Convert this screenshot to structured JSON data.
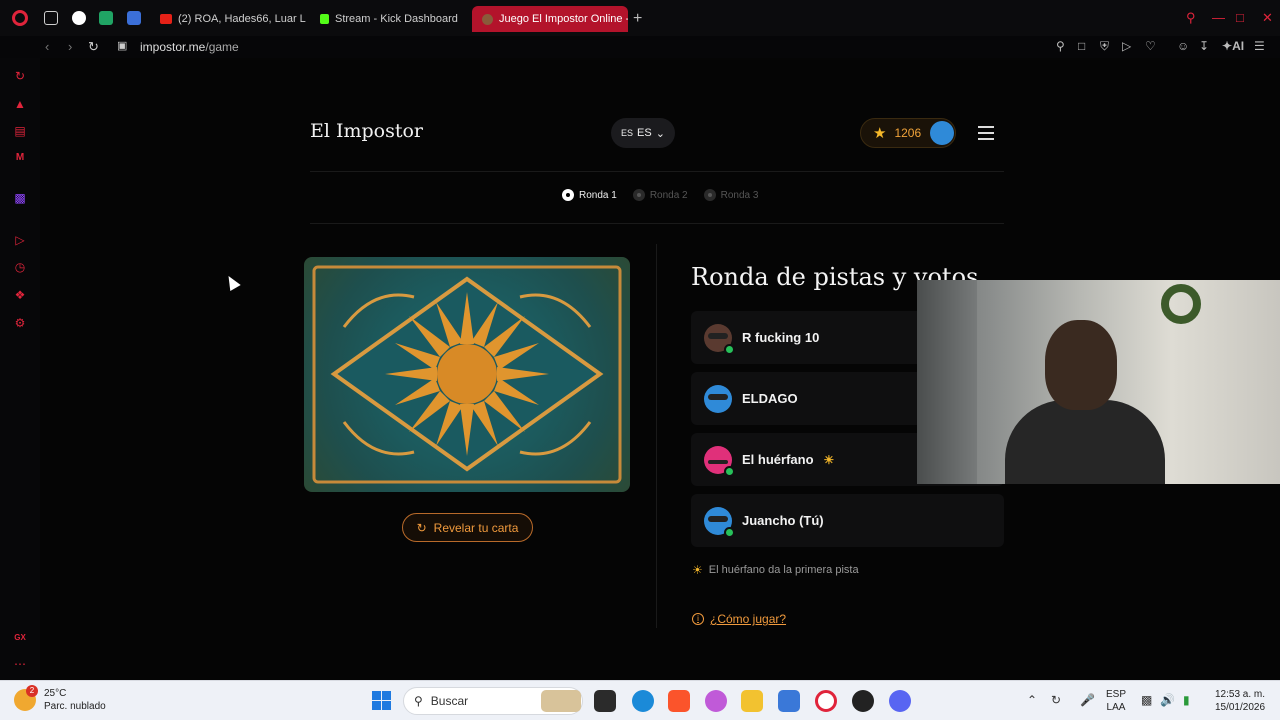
{
  "browser": {
    "tabs": [
      {
        "title": "(2) ROA, Hades66, Luar La",
        "favicon_color": "#e62117"
      },
      {
        "title": "Stream - Kick Dashboard",
        "favicon_color": "#53fc18"
      },
      {
        "title": "Juego El Impostor Online -",
        "favicon_color": "#8a5a3a",
        "active": true
      }
    ],
    "pinned_mini_tabs": [
      {
        "icon": "window-icon",
        "color": "#cfcfcf"
      },
      {
        "icon": "record-icon",
        "color": "#ffffff"
      },
      {
        "icon": "sheets-icon",
        "color": "#20a464"
      },
      {
        "icon": "calendar-icon",
        "color": "#3b6fd8"
      }
    ],
    "url_host": "impostor.me",
    "url_path": "/game",
    "ai_label": "AI"
  },
  "site": {
    "title": "El Impostor",
    "lang_flag": "ES",
    "lang_code": "ES",
    "points": "1206"
  },
  "rounds": [
    {
      "label": "Ronda 1",
      "active": true
    },
    {
      "label": "Ronda 2",
      "active": false
    },
    {
      "label": "Ronda 3",
      "active": false
    }
  ],
  "card": {
    "reveal_label": "Revelar tu carta"
  },
  "game": {
    "section_title": "Ronda de pistas y votos",
    "players": [
      {
        "name": "R fucking 10",
        "avatar_color": "#5a3a30"
      },
      {
        "name": "ELDAGO",
        "avatar_color": "#2f8ad8"
      },
      {
        "name": "El huérfano",
        "avatar_color": "#e0307a",
        "first": true
      },
      {
        "name": "Juancho (Tú)",
        "avatar_color": "#2f8ad8"
      }
    ],
    "first_clue_text": "El huérfano da la primera pista",
    "howto_label": "¿Cómo jugar?"
  },
  "taskbar": {
    "weather_temp": "25°C",
    "weather_desc": "Parc. nublado",
    "weather_badge": "2",
    "search_label": "Buscar",
    "lang_line1": "ESP",
    "lang_line2": "LAA",
    "time": "12:53 a. m.",
    "date": "15/01/2026"
  },
  "sidebar": {
    "bottom_label": "GX"
  }
}
